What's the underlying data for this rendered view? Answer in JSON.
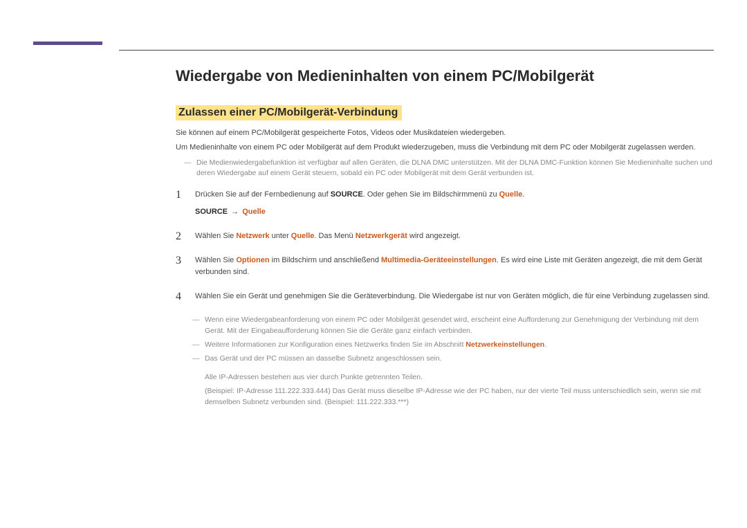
{
  "header": {
    "title": "Wiedergabe von Medieninhalten von einem PC/Mobilgerät"
  },
  "section": {
    "subheading": "Zulassen einer PC/Mobilgerät-Verbindung",
    "intro1": "Sie können auf einem PC/Mobilgerät gespeicherte Fotos, Videos oder Musikdateien wiedergeben.",
    "intro2": "Um Medieninhalte von einem PC oder Mobilgerät auf dem Produkt wiederzugeben, muss die Verbindung mit dem PC oder Mobilgerät zugelassen werden.",
    "topnote": "Die Medienwiedergabefunktion ist verfügbar auf allen Geräten, die DLNA DMC unterstützen. Mit der DLNA DMC-Funktion können Sie Medieninhalte suchen und deren Wiedergabe auf einem Gerät steuern, sobald ein PC oder Mobilgerät mit dem Gerät verbunden ist."
  },
  "steps": {
    "s1": {
      "pre": "Drücken Sie auf der Fernbedienung auf ",
      "source": "SOURCE",
      "mid": ". Oder gehen Sie im Bildschirmmenü zu ",
      "quelle": "Quelle",
      "post": ".",
      "sub_source": "SOURCE",
      "sub_arrow": "→",
      "sub_quelle": "Quelle"
    },
    "s2": {
      "pre": "Wählen Sie ",
      "netzwerk": "Netzwerk",
      "mid1": " unter ",
      "quelle": "Quelle",
      "mid2": ". Das Menü ",
      "netzwerkgeraet": "Netzwerkgerät",
      "post": " wird angezeigt."
    },
    "s3": {
      "pre": "Wählen Sie ",
      "optionen": "Optionen",
      "mid1": " im Bildschirm und anschließend ",
      "multi": "Multimedia-Geräteeinstellungen",
      "post": ". Es wird eine Liste mit Geräten angezeigt, die mit dem Gerät verbunden sind."
    },
    "s4": {
      "text": "Wählen Sie ein Gerät und genehmigen Sie die Geräteverbindung. Die Wiedergabe ist nur von Geräten möglich, die für eine Verbindung zugelassen sind."
    }
  },
  "bottomnotes": {
    "n1": "Wenn eine Wiedergabeanforderung von einem PC oder Mobilgerät gesendet wird, erscheint eine Aufforderung zur Genehmigung der Verbindung mit dem Gerät. Mit der Eingabeaufforderung können Sie die Geräte ganz einfach verbinden.",
    "n2_pre": "Weitere Informationen zur Konfiguration eines Netzwerks finden Sie im Abschnitt ",
    "n2_hl": "Netzwerkeinstellungen",
    "n2_post": ".",
    "n3": "Das Gerät und der PC müssen an dasselbe Subnetz angeschlossen sein.",
    "n3_sub1": "Alle IP-Adressen bestehen aus vier durch Punkte getrennten Teilen.",
    "n3_sub2": "(Beispiel: IP-Adresse 111.222.333.444) Das Gerät muss dieselbe IP-Adresse wie der PC haben, nur der vierte Teil muss unterschiedlich sein, wenn sie mit demselben Subnetz verbunden sind. (Beispiel: 111.222.333.***)"
  }
}
